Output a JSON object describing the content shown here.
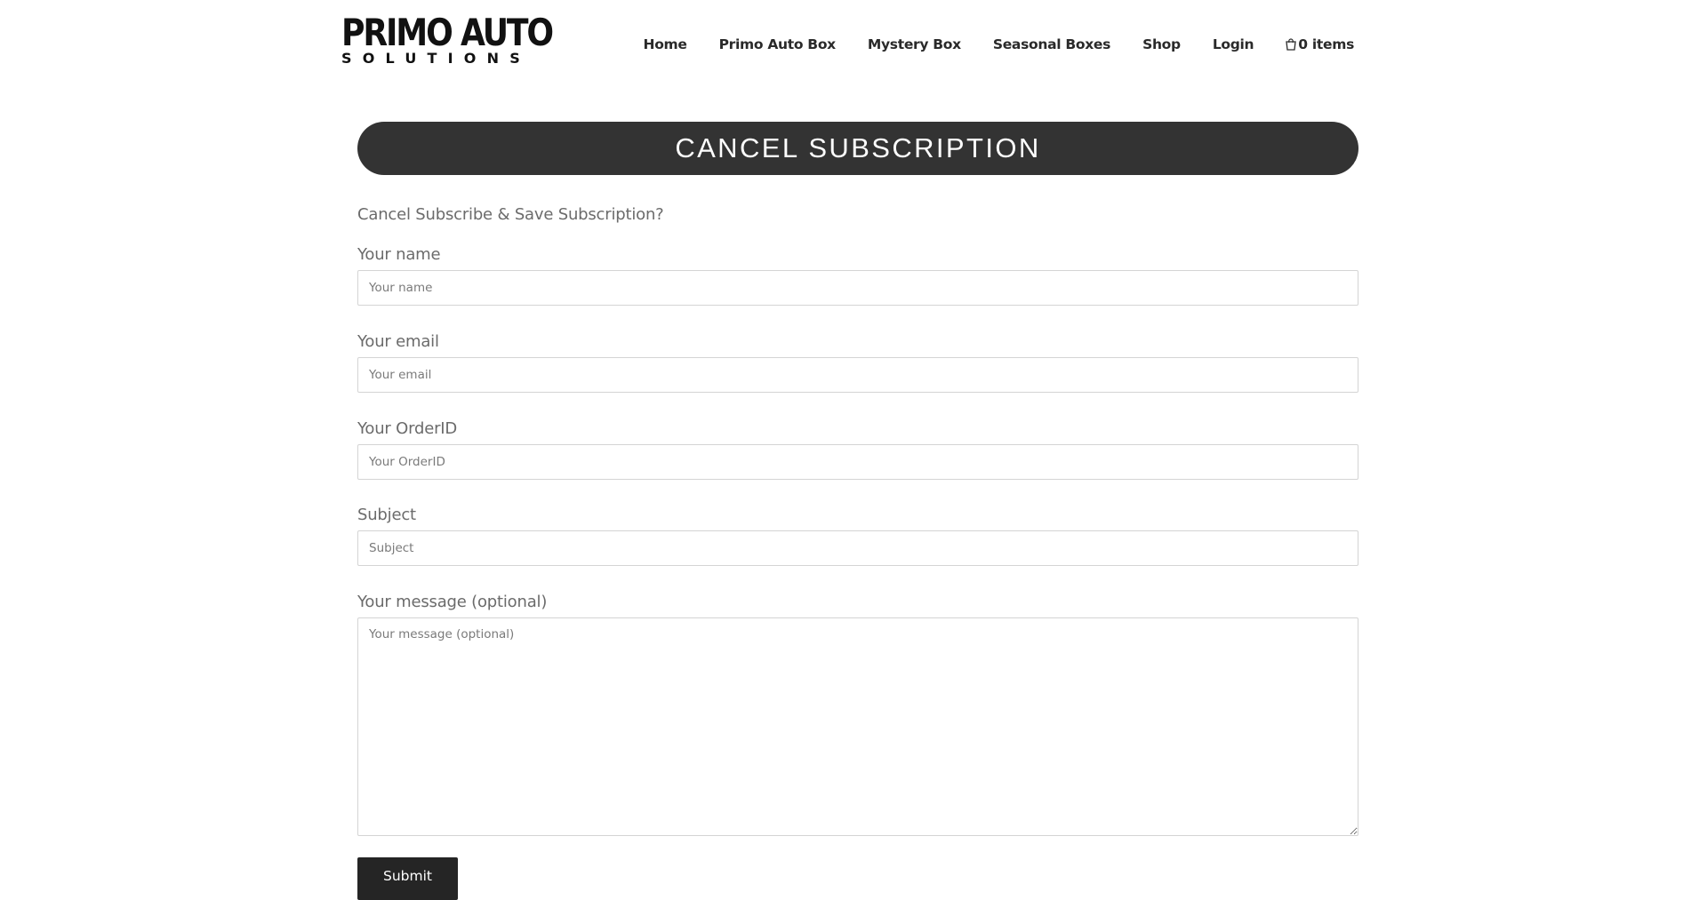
{
  "brand": {
    "line1": "PRIMO AUTO",
    "line2": "SOLUTIONS"
  },
  "nav": {
    "items": [
      {
        "label": "Home"
      },
      {
        "label": "Primo Auto Box"
      },
      {
        "label": "Mystery Box"
      },
      {
        "label": "Seasonal Boxes"
      },
      {
        "label": "Shop"
      },
      {
        "label": "Login"
      }
    ],
    "cart": {
      "icon": "cart-icon",
      "label": "0 items"
    }
  },
  "page": {
    "title": "CANCEL SUBSCRIPTION",
    "intro": "Cancel Subscribe & Save Subscription?"
  },
  "form": {
    "name": {
      "label": "Your name",
      "placeholder": "Your name",
      "value": ""
    },
    "email": {
      "label": "Your email",
      "placeholder": "Your email",
      "value": ""
    },
    "order_id": {
      "label": "Your OrderID",
      "placeholder": "Your OrderID",
      "value": ""
    },
    "subject": {
      "label": "Subject",
      "placeholder": "Subject",
      "value": ""
    },
    "message": {
      "label": "Your message (optional)",
      "placeholder": "Your message (optional)",
      "value": ""
    },
    "submit_label": "Submit"
  },
  "colors": {
    "title_bar": "#333333",
    "submit_button": "#252525",
    "label_text": "#6b6b6b",
    "nav_text": "#2a2a2a"
  }
}
